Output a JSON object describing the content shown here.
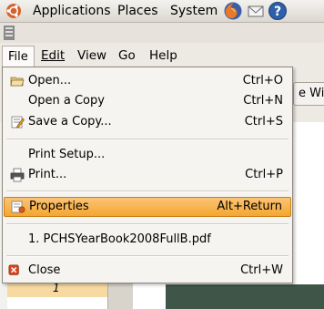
{
  "panel": {
    "applications": "Applications",
    "places": "Places",
    "system": "System",
    "launchers": [
      "firefox-icon",
      "mail-icon",
      "help-icon"
    ]
  },
  "menubar": {
    "file": "File",
    "edit": "Edit",
    "view": "View",
    "go": "Go",
    "help": "Help"
  },
  "toolbar": {
    "partial_button": "e Wid"
  },
  "sidebar": {
    "page_label": "1"
  },
  "file_menu": {
    "items": [
      {
        "label": "Open...",
        "accel": "Ctrl+O",
        "icon": "folder-open-icon"
      },
      {
        "label": "Open a Copy",
        "accel": "Ctrl+N",
        "icon": ""
      },
      {
        "label": "Save a Copy...",
        "accel": "Ctrl+S",
        "icon": "save-copy-icon"
      },
      {
        "label": "Print Setup...",
        "accel": "",
        "icon": ""
      },
      {
        "label": "Print...",
        "accel": "Ctrl+P",
        "icon": "printer-icon"
      },
      {
        "label": "Properties",
        "accel": "Alt+Return",
        "icon": "properties-icon"
      },
      {
        "label": "1.  PCHSYearBook2008FullB.pdf",
        "accel": "",
        "icon": ""
      },
      {
        "label": "Close",
        "accel": "Ctrl+W",
        "icon": "close-icon"
      }
    ]
  },
  "colors": {
    "highlight": "#f4a62f",
    "panel_bg": "#e4e0d9",
    "menu_bg": "#f6f4f1"
  }
}
